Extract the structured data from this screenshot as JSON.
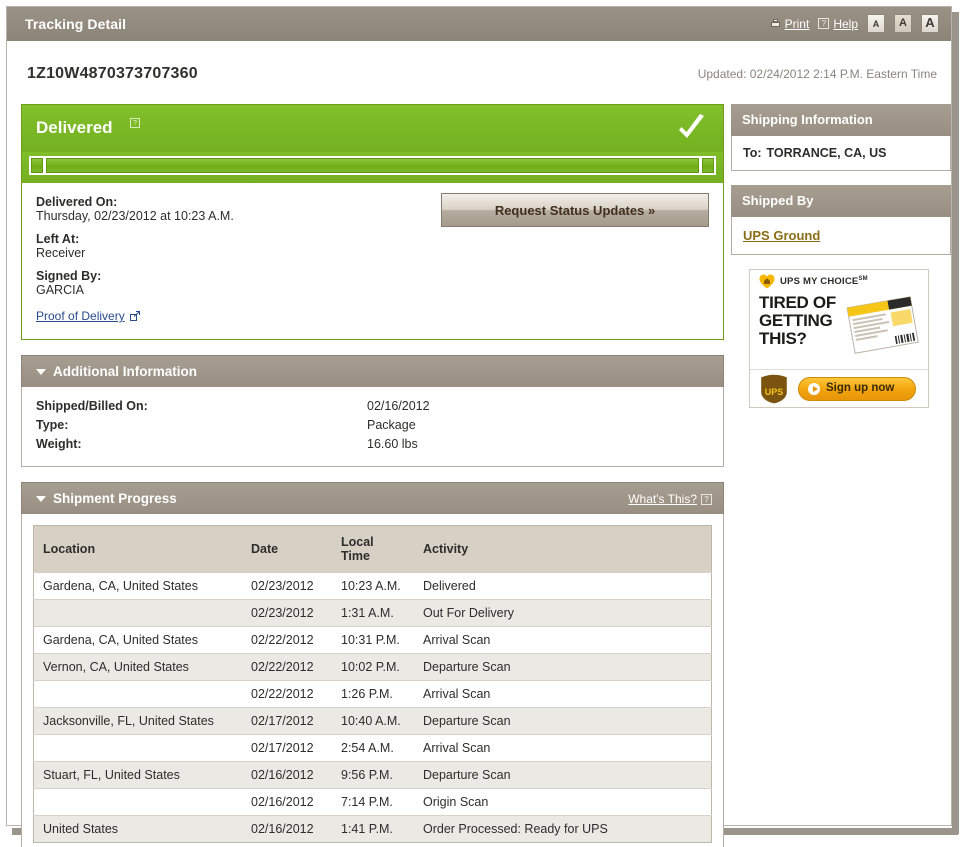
{
  "window": {
    "title": "Tracking Detail",
    "print_label": "Print",
    "help_label": "Help",
    "text_size_small": "A",
    "text_size_medium": "A",
    "text_size_large": "A"
  },
  "header": {
    "tracking_number": "1Z10W4870373707360",
    "updated": "Updated: 02/24/2012 2:14 P.M. Eastern Time"
  },
  "status": {
    "label": "Delivered",
    "help_glyph": "?",
    "progress_percent": 100,
    "delivered_on_label": "Delivered On:",
    "delivered_on_value": "Thursday,  02/23/2012 at 10:23 A.M.",
    "left_at_label": "Left At:",
    "left_at_value": "Receiver",
    "signed_by_label": "Signed By:",
    "signed_by_value": "GARCIA",
    "proof_link": "Proof of Delivery",
    "request_updates_button": "Request Status Updates »"
  },
  "additional_information": {
    "title": "Additional Information",
    "rows": [
      {
        "key": "Shipped/Billed On:",
        "value": "02/16/2012"
      },
      {
        "key": "Type:",
        "value": "Package"
      },
      {
        "key": "Weight:",
        "value": "16.60 lbs"
      }
    ]
  },
  "shipment_progress": {
    "title": "Shipment Progress",
    "whats_this": "What's This?",
    "whats_this_glyph": "?",
    "columns": [
      "Location",
      "Date",
      "Local Time",
      "Activity"
    ],
    "rows": [
      {
        "location": "Gardena, CA, United States",
        "date": "02/23/2012",
        "time": "10:23 A.M.",
        "activity": "Delivered"
      },
      {
        "location": "",
        "date": "02/23/2012",
        "time": "1:31 A.M.",
        "activity": "Out For Delivery"
      },
      {
        "location": "Gardena, CA, United States",
        "date": "02/22/2012",
        "time": "10:31 P.M.",
        "activity": "Arrival Scan"
      },
      {
        "location": "Vernon, CA, United States",
        "date": "02/22/2012",
        "time": "10:02 P.M.",
        "activity": "Departure Scan"
      },
      {
        "location": "",
        "date": "02/22/2012",
        "time": "1:26 P.M.",
        "activity": "Arrival Scan"
      },
      {
        "location": "Jacksonville, FL, United States",
        "date": "02/17/2012",
        "time": "10:40 A.M.",
        "activity": "Departure Scan"
      },
      {
        "location": "",
        "date": "02/17/2012",
        "time": "2:54 A.M.",
        "activity": "Arrival Scan"
      },
      {
        "location": "Stuart, FL, United States",
        "date": "02/16/2012",
        "time": "9:56 P.M.",
        "activity": "Departure Scan"
      },
      {
        "location": "",
        "date": "02/16/2012",
        "time": "7:14 P.M.",
        "activity": "Origin Scan"
      },
      {
        "location": "United States",
        "date": "02/16/2012",
        "time": "1:41 P.M.",
        "activity": "Order Processed: Ready for UPS"
      }
    ]
  },
  "sidebar": {
    "shipping_information": {
      "title": "Shipping Information",
      "to_label": "To:",
      "to_value": "TORRANCE, CA, US"
    },
    "shipped_by": {
      "title": "Shipped By",
      "service": "UPS Ground"
    },
    "ad": {
      "brand": "UPS MY CHOICE",
      "brand_sup": "SM",
      "headline_line1": "TIRED OF",
      "headline_line2": "GETTING",
      "headline_line3": "THIS?",
      "cta": "Sign up now"
    }
  },
  "colors": {
    "green": "#7ab62a",
    "taupe": "#988e81",
    "title_bar": "#958c80",
    "table_header": "#d7d1c5",
    "row_alt": "#ebe9e4",
    "link_blue": "#2a4b8d",
    "link_gold": "#8a6d15",
    "ad_orange": "#f2a50e"
  }
}
